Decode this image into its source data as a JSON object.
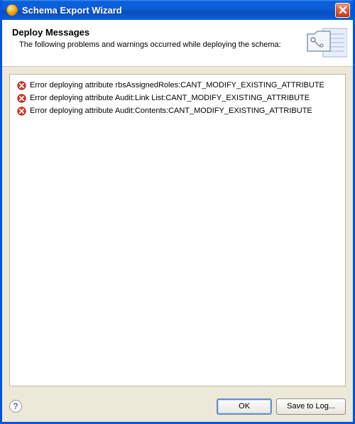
{
  "window": {
    "title": "Schema Export Wizard"
  },
  "header": {
    "heading": "Deploy Messages",
    "subtext": "The following problems and warnings occurred while deploying the schema:"
  },
  "messages": [
    {
      "kind": "error",
      "text": "Error deploying attribute rbsAssignedRoles:CANT_MODIFY_EXISTING_ATTRIBUTE"
    },
    {
      "kind": "error",
      "text": "Error deploying attribute Audit:Link List:CANT_MODIFY_EXISTING_ATTRIBUTE"
    },
    {
      "kind": "error",
      "text": "Error deploying attribute Audit:Contents:CANT_MODIFY_EXISTING_ATTRIBUTE"
    }
  ],
  "footer": {
    "help_symbol": "?",
    "ok_label": "OK",
    "save_label": "Save to Log..."
  }
}
